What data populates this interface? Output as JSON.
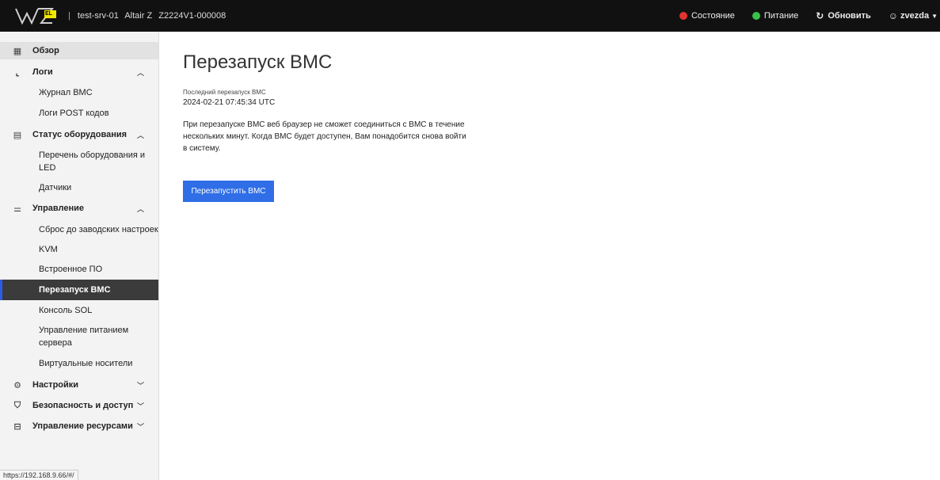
{
  "header": {
    "separator": "|",
    "hostname": "test-srv-01",
    "model": "Altair Z",
    "serial": "Z2224V1-000008",
    "logo_badge": "EL",
    "status_label": "Состояние",
    "power_label": "Питание",
    "refresh_label": "Обновить",
    "user_label": "zvezda"
  },
  "sidebar": {
    "overview": "Обзор",
    "logs": "Логи",
    "logs_items": [
      "Журнал BMC",
      "Логи POST кодов"
    ],
    "hardware": "Статус оборудования",
    "hardware_items": [
      "Перечень оборудования и LED",
      "Датчики"
    ],
    "control": "Управление",
    "control_items": [
      "Сброс до заводских настроек",
      "KVM",
      "Встроенное ПО",
      "Перезапуск BMC",
      "Консоль SOL",
      "Управление питанием сервера",
      "Виртуальные носители"
    ],
    "settings": "Настройки",
    "security": "Безопасность и доступ",
    "resources": "Управление ресурсами"
  },
  "status_bar": {
    "url": "https://192.168.9.66/#/"
  },
  "main": {
    "title": "Перезапуск BMC",
    "last_reboot_label": "Последний перезапуск BMC",
    "last_reboot_value": "2024-02-21 07:45:34 UTC",
    "info_text": "При перезапуске BMC веб браузер не сможет соединиться с BMC в течение нескольких минут. Когда BMC будет доступен, Вам понадобится снова войти в систему.",
    "reboot_button": "Перезапустить BMC"
  },
  "colors": {
    "accent": "#2f6ee6",
    "topbar": "#111111",
    "status_error": "#e3342f",
    "status_ok": "#3ac14a"
  }
}
